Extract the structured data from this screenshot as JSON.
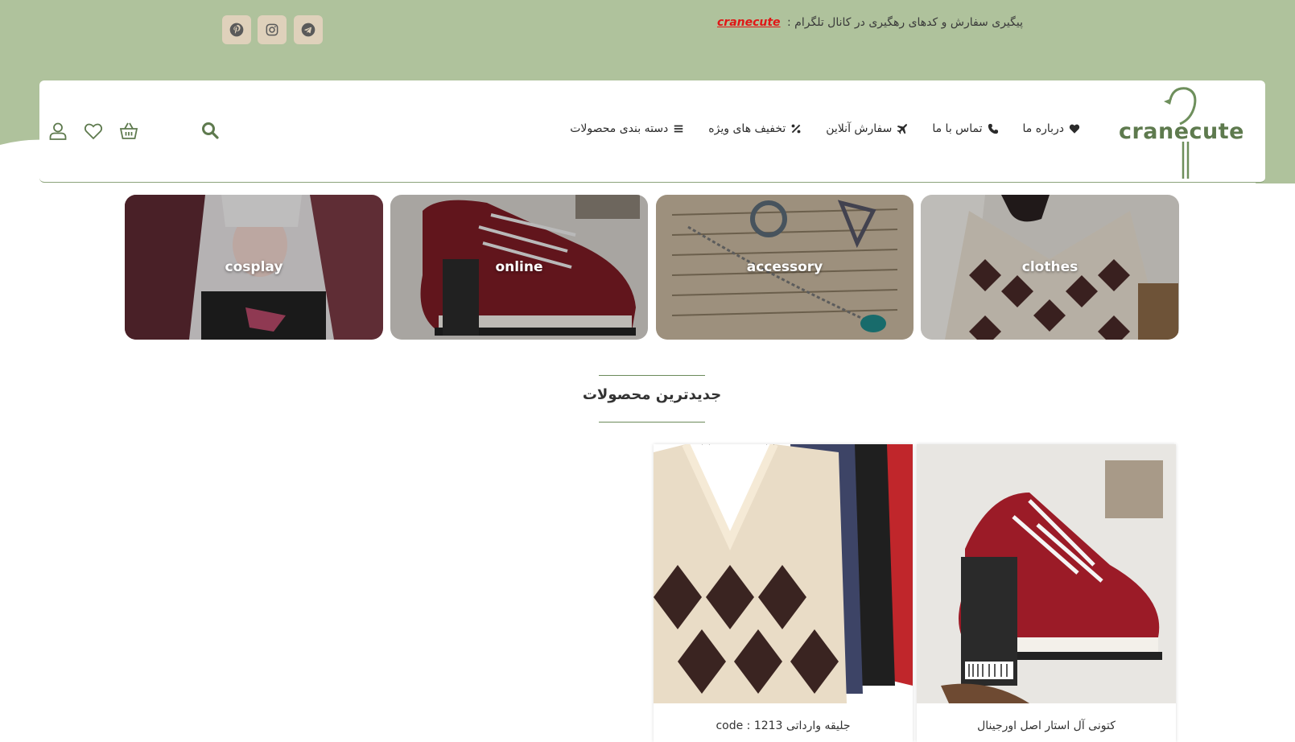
{
  "topbar": {
    "message": "پیگیری سفارش و کدهای رهگیری در کانال تلگرام :",
    "channel_link": "cranecute",
    "social": [
      {
        "icon": "pinterest-icon"
      },
      {
        "icon": "instagram-icon"
      },
      {
        "icon": "telegram-icon"
      }
    ]
  },
  "header": {
    "logo_text": "cranecute",
    "nav": [
      {
        "label": "دسته بندی محصولات",
        "icon": "menu-icon"
      },
      {
        "label": "تخفیف های ویژه",
        "icon": "percent-icon"
      },
      {
        "label": "سفارش آنلاین",
        "icon": "plane-icon"
      },
      {
        "label": "تماس با ما",
        "icon": "phone-icon"
      },
      {
        "label": "درباره ما",
        "icon": "heart-icon"
      }
    ]
  },
  "categories": [
    {
      "label": "cosplay"
    },
    {
      "label": "online"
    },
    {
      "label": "accessory"
    },
    {
      "label": "clothes"
    }
  ],
  "section": {
    "title": "جدیدترین محصولات"
  },
  "products": [
    {
      "name": "جلیقه وارداتی code : 1213"
    },
    {
      "name": "کتونی آل استار اصل اورجینال"
    }
  ],
  "colors": {
    "topbar_bg": "#afc29c",
    "accent": "#5e7a4e",
    "link_red": "#e01717",
    "social_bg": "#dfd1bb"
  }
}
